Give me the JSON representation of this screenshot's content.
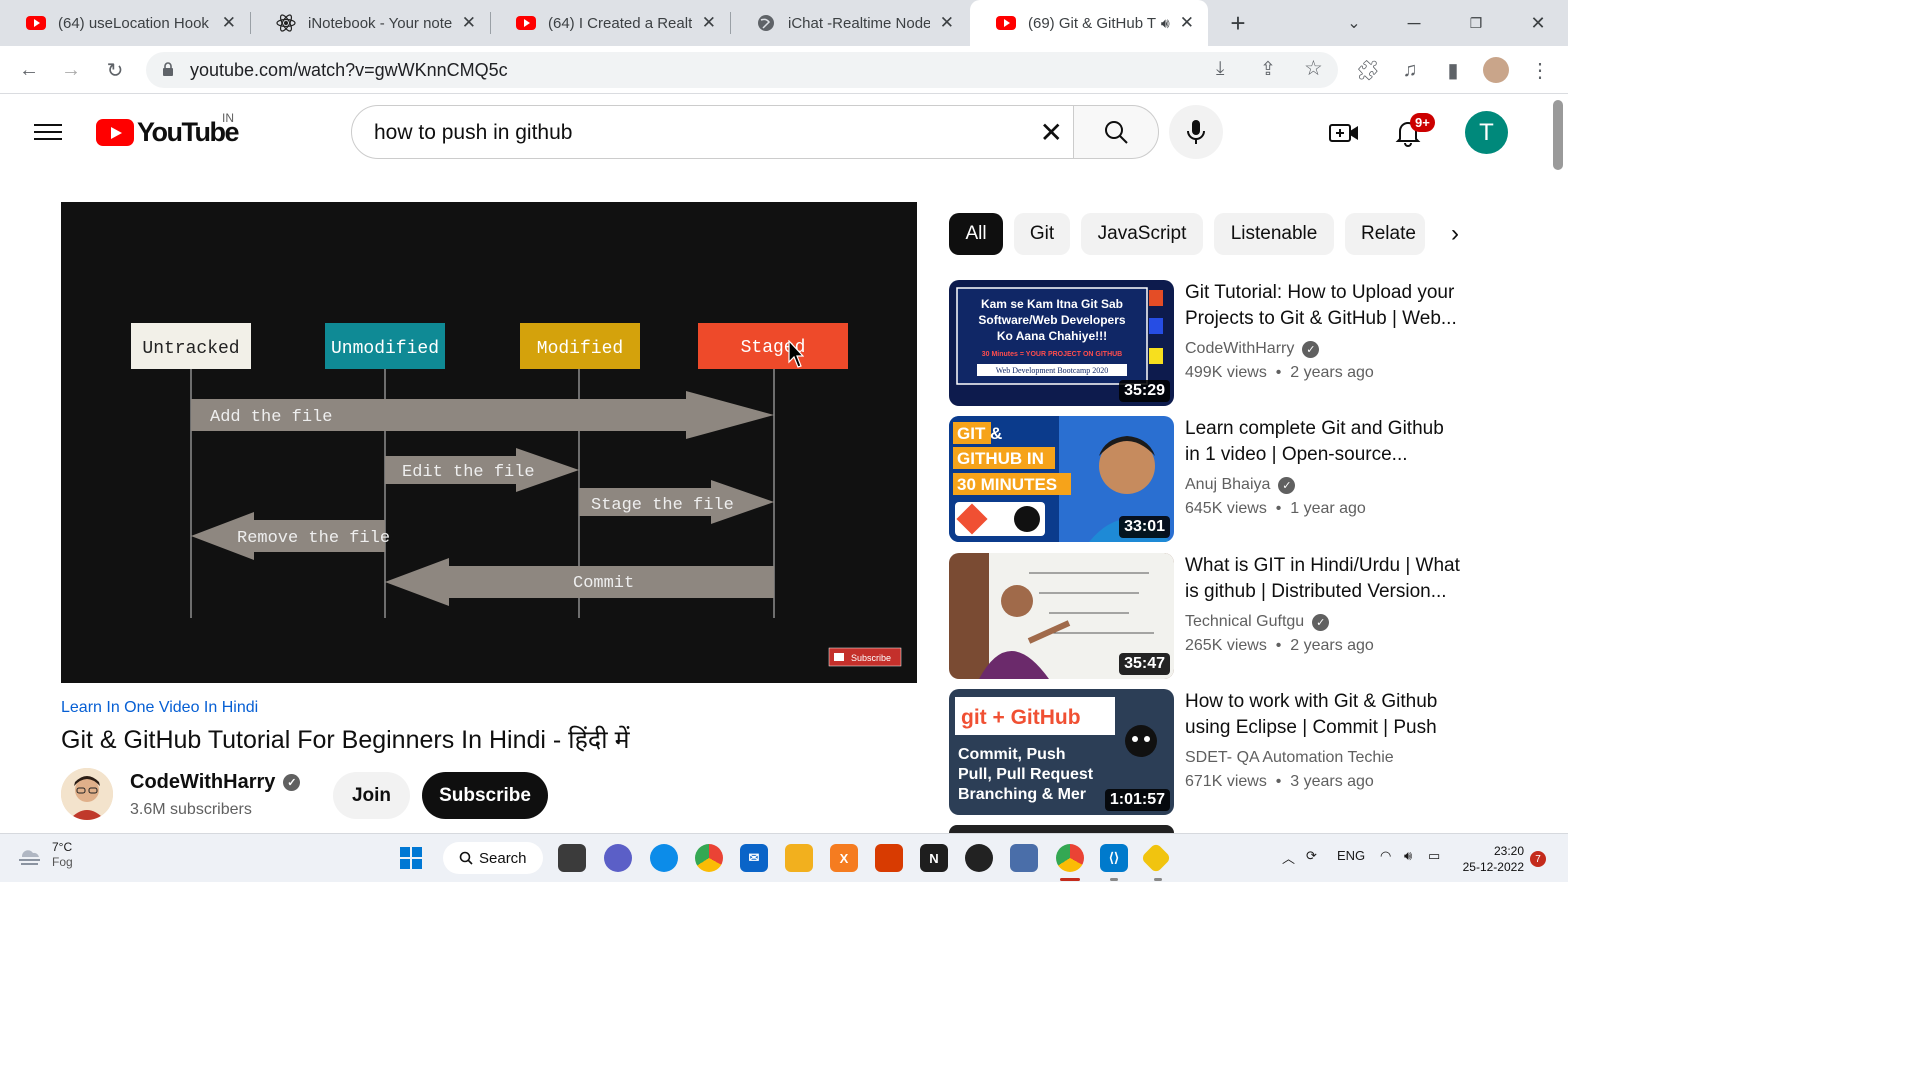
{
  "browser": {
    "tabs": [
      {
        "title": "(64) useLocation Hook I",
        "icon": "youtube-icon",
        "active": false
      },
      {
        "title": "iNotebook - Your notes",
        "icon": "react-icon",
        "active": false
      },
      {
        "title": "(64) I Created a Realtim",
        "icon": "youtube-icon",
        "active": false
      },
      {
        "title": "iChat -Realtime Node S",
        "icon": "globe-icon",
        "active": false
      },
      {
        "title": "(69) Git & GitHub T",
        "icon": "youtube-icon",
        "active": true
      }
    ],
    "url": "youtube.com/watch?v=gwWKnnCMQ5c"
  },
  "youtube": {
    "country_code": "IN",
    "logo_text": "YouTube",
    "search_query": "how to push in github",
    "notification_count": "9+",
    "avatar_letter": "T"
  },
  "video": {
    "slide": {
      "states": [
        "Untracked",
        "Unmodified",
        "Modified",
        "Staged"
      ],
      "state_colors": [
        "#f2f0e8",
        "#0f8a95",
        "#d4a20c",
        "#ee4a2a"
      ],
      "actions": [
        "Add the file",
        "Edit the file",
        "Stage the file",
        "Remove the file",
        "Commit"
      ],
      "subscribe_watermark": "Subscribe"
    },
    "hashtag": "Learn In One Video In Hindi",
    "title": "Git & GitHub Tutorial For Beginners In Hindi - हिंदी में",
    "channel": "CodeWithHarry",
    "subscribers": "3.6M subscribers",
    "join_label": "Join",
    "subscribe_label": "Subscribe"
  },
  "chips": [
    "All",
    "Git",
    "JavaScript",
    "Listenable",
    "Relate"
  ],
  "recommendations": [
    {
      "title": "Git Tutorial: How to Upload your Projects to Git & GitHub | Web...",
      "channel": "CodeWithHarry",
      "verified": true,
      "views": "499K views",
      "age": "2 years ago",
      "duration": "35:29",
      "thumb_lines": [
        "Kam se Kam Itna Git Sab",
        "Software/Web Developers",
        "Ko Aana Chahiye!!!",
        "30 Minutes = YOUR PROJECT ON GITHUB",
        "Web Development Bootcamp 2020"
      ]
    },
    {
      "title": "Learn complete Git and Github in 1 video | Open-source...",
      "channel": "Anuj Bhaiya",
      "verified": true,
      "views": "645K views",
      "age": "1 year ago",
      "duration": "33:01",
      "thumb_lines": [
        "GIT &",
        "GITHUB IN",
        "30 MINUTES"
      ]
    },
    {
      "title": "What is GIT in Hindi/Urdu | What is github | Distributed Version...",
      "channel": "Technical Guftgu",
      "verified": true,
      "views": "265K views",
      "age": "2 years ago",
      "duration": "35:47",
      "thumb_lines": []
    },
    {
      "title": "How to work with Git & Github using Eclipse | Commit | Push |...",
      "channel": "SDET- QA Automation Techie",
      "verified": false,
      "views": "671K views",
      "age": "3 years ago",
      "duration": "1:01:57",
      "thumb_lines": [
        "git + GitHub",
        "Commit, Push",
        "Pull, Pull Request",
        "Branching & Mer"
      ]
    }
  ],
  "taskbar": {
    "weather_temp": "7°C",
    "weather_desc": "Fog",
    "search_label": "Search",
    "lang": "ENG",
    "time": "23:20",
    "date": "25-12-2022",
    "notifications": "7"
  }
}
